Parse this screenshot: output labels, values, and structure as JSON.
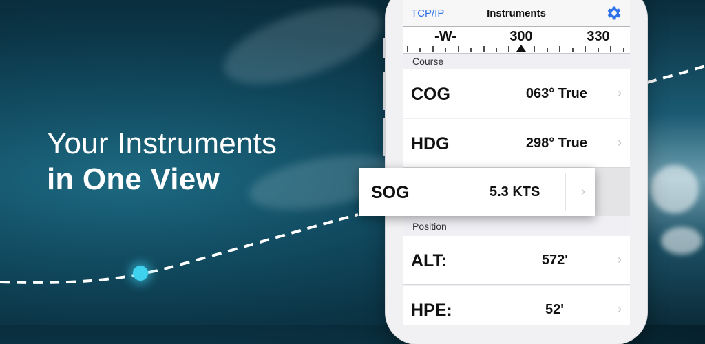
{
  "headline": {
    "line1": "Your Instruments",
    "line2": "in One View"
  },
  "app": {
    "nav_left": "TCP/IP",
    "title": "Instruments",
    "settings_icon": "gear-icon",
    "accent_color": "#2f73e9"
  },
  "compass": {
    "labels": [
      "-W-",
      "300",
      "330"
    ]
  },
  "sections": {
    "course": "Course",
    "position": "Position"
  },
  "rows": {
    "cog": {
      "label": "COG",
      "value": "063° True"
    },
    "hdg": {
      "label": "HDG",
      "value": "298° True"
    },
    "sog": {
      "label": "SOG",
      "value": "5.3 KTS"
    },
    "alt": {
      "label": "ALT:",
      "value": "572'"
    },
    "hpe": {
      "label": "HPE:",
      "value": "52'"
    }
  },
  "chevron": "›"
}
